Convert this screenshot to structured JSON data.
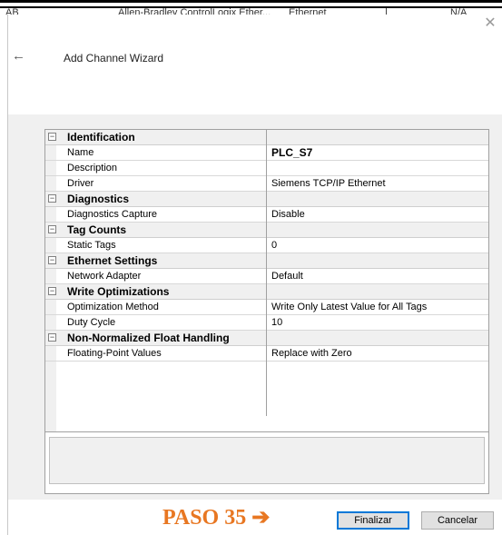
{
  "background": {
    "row_texts": [
      "AB",
      "Allen-Bradley ControlLogix Ether...",
      "Ethernet",
      "N/A"
    ]
  },
  "dialog": {
    "title": "Add Channel Wizard",
    "close_icon": "close-icon",
    "back_icon": "arrow-left-icon"
  },
  "property_grid": {
    "categories": [
      {
        "name": "Identification",
        "properties": [
          {
            "label": "Name",
            "value": "PLC_S7",
            "bold": true
          },
          {
            "label": "Description",
            "value": ""
          },
          {
            "label": "Driver",
            "value": "Siemens TCP/IP Ethernet"
          }
        ]
      },
      {
        "name": "Diagnostics",
        "properties": [
          {
            "label": "Diagnostics Capture",
            "value": "Disable"
          }
        ]
      },
      {
        "name": "Tag Counts",
        "properties": [
          {
            "label": "Static Tags",
            "value": "0"
          }
        ]
      },
      {
        "name": "Ethernet Settings",
        "properties": [
          {
            "label": "Network Adapter",
            "value": "Default"
          }
        ]
      },
      {
        "name": "Write Optimizations",
        "properties": [
          {
            "label": "Optimization Method",
            "value": "Write Only Latest Value for All Tags"
          },
          {
            "label": "Duty Cycle",
            "value": "10"
          }
        ]
      },
      {
        "name": "Non-Normalized Float Handling",
        "properties": [
          {
            "label": "Floating-Point Values",
            "value": "Replace with Zero"
          }
        ]
      }
    ],
    "collapse_glyph": "⊟"
  },
  "footer": {
    "step_annotation": "PASO 35 ➔",
    "finish_label": "Finalizar",
    "cancel_label": "Cancelar"
  },
  "colors": {
    "annotation": "#e87722",
    "primary_border": "#0078d7",
    "panel_background": "#f0f0f0"
  }
}
